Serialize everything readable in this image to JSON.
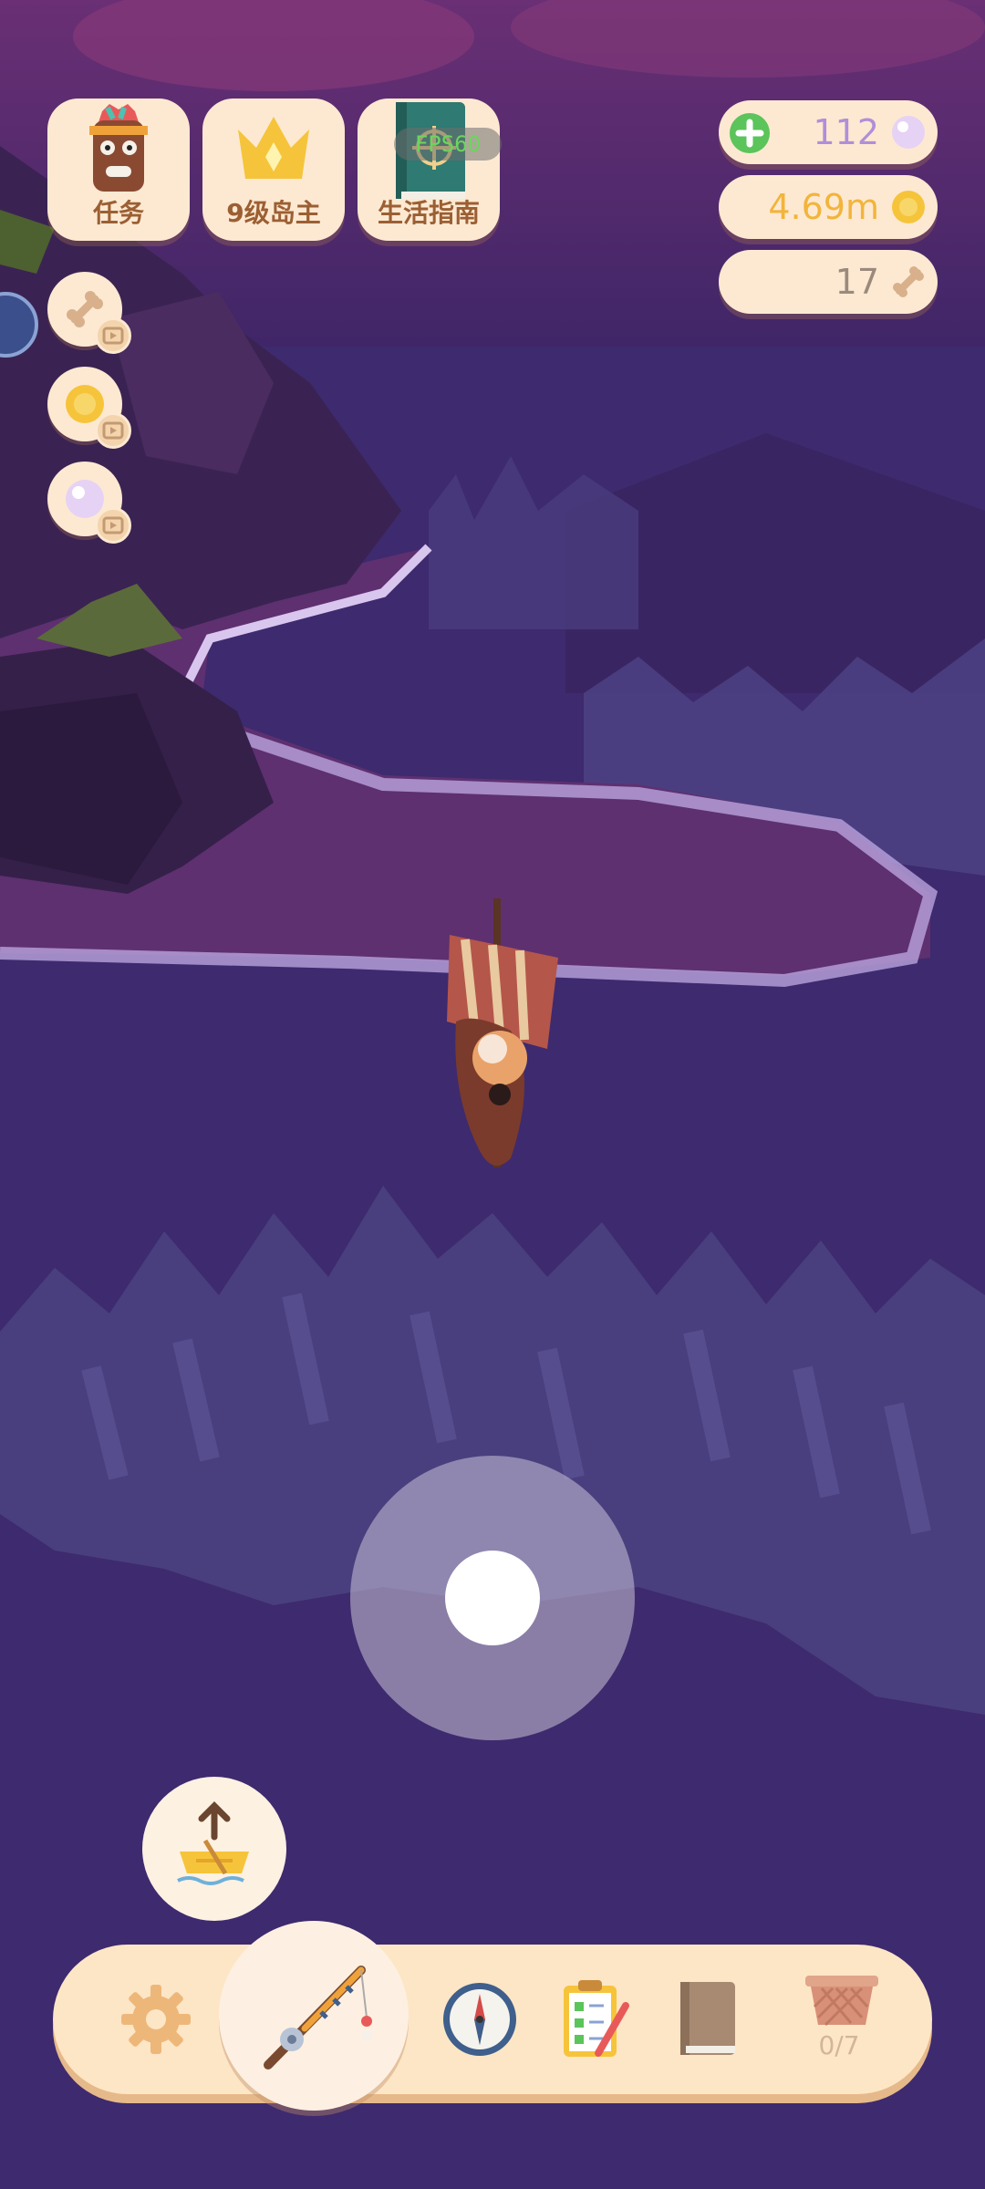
{
  "menu": {
    "tasks_label": "任务",
    "island_label": "9级岛主",
    "guide_label": "生活指南"
  },
  "fps_overlay": "FPS60",
  "resources": {
    "pearls": "112",
    "coins": "4.69m",
    "bones": "17"
  },
  "toolbar": {
    "basket_count": "0/7"
  },
  "colors": {
    "panel": "#fde9d2",
    "pearl_text": "#b08fd8",
    "coin_text": "#f2b43a",
    "bone_text": "#9b8a7c",
    "label_text": "#9b5f33"
  }
}
